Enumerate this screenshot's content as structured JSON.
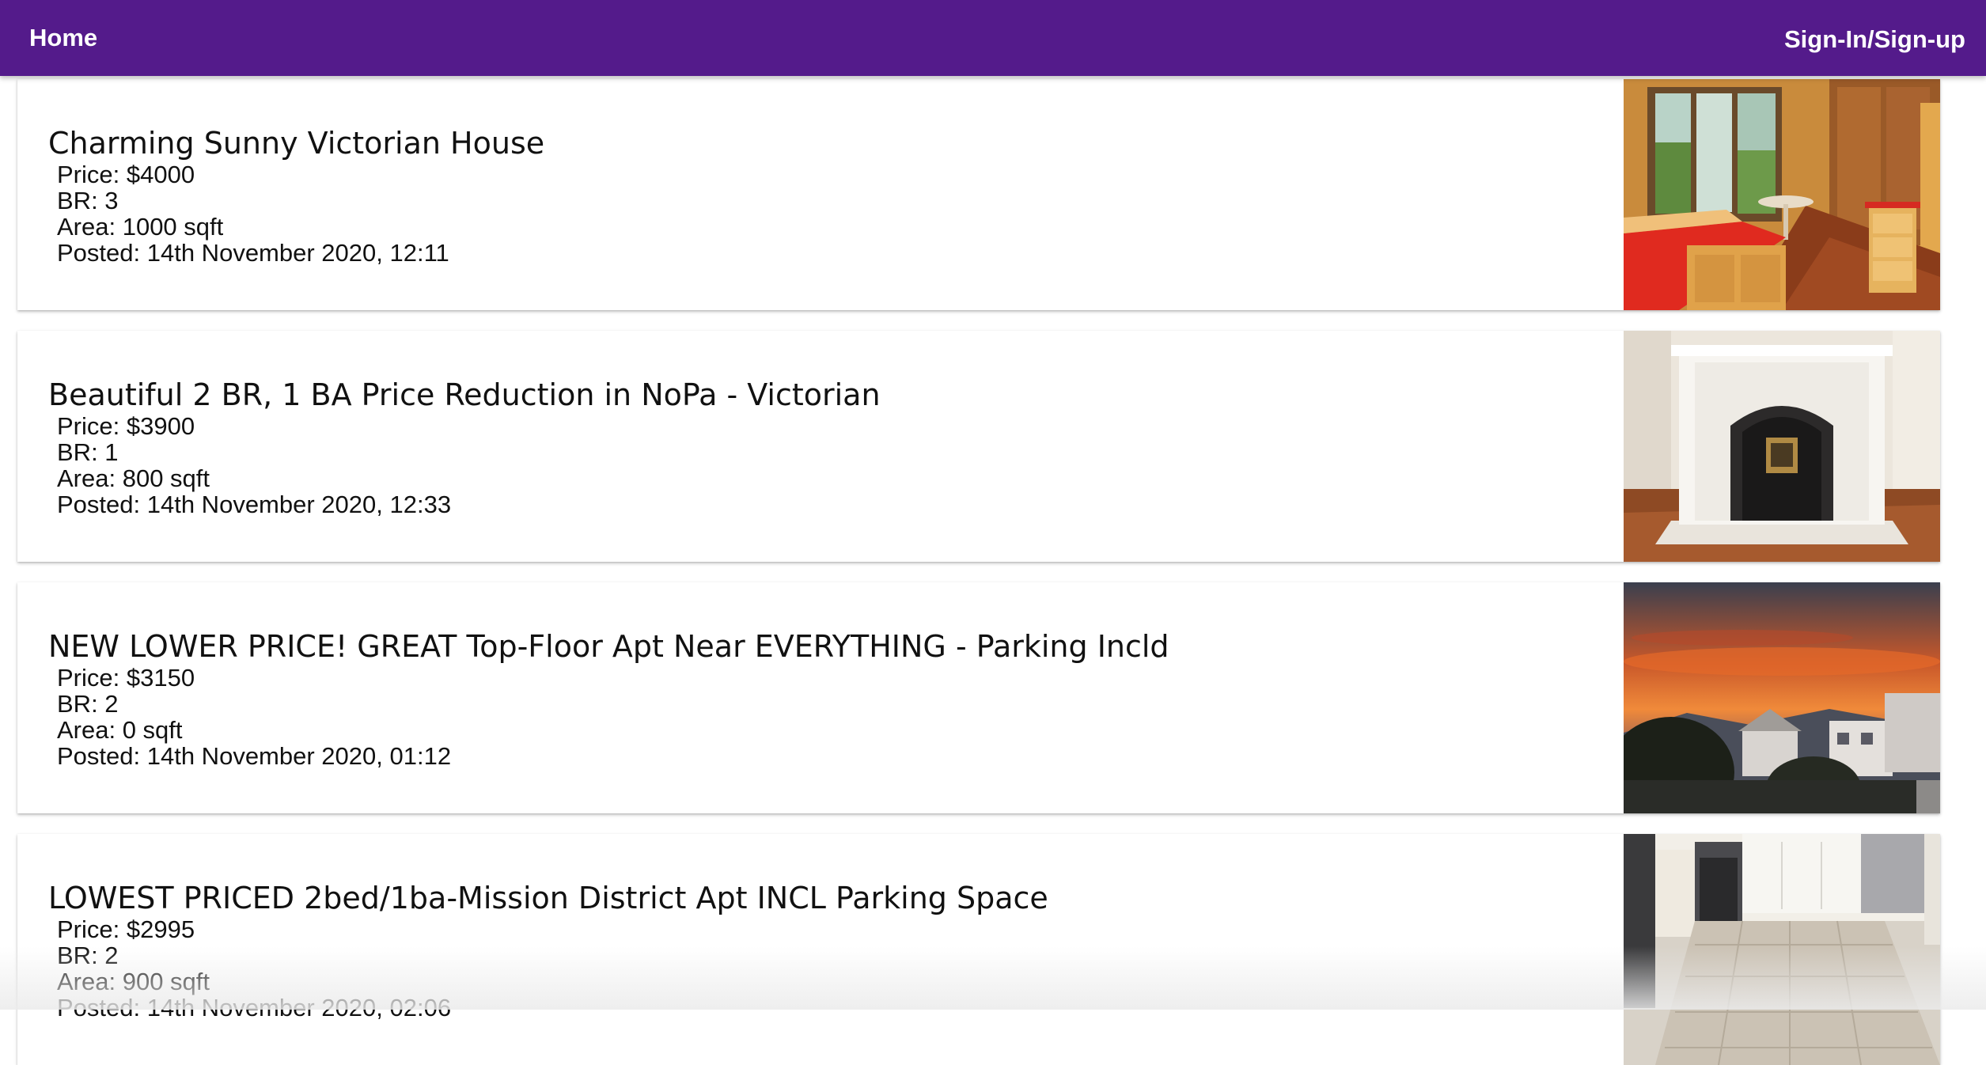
{
  "navbar": {
    "home_label": "Home",
    "signin_label": "Sign-In/Sign-up",
    "background_color": "#541b8b"
  },
  "listings": [
    {
      "title": "Charming Sunny Victorian House",
      "price": "Price: $4000",
      "br": "BR: 3",
      "area": "Area: 1000 sqft",
      "posted": "Posted: 14th November 2020, 12:11",
      "image": "kitchen-photo"
    },
    {
      "title": "Beautiful 2 BR, 1 BA Price Reduction in NoPa - Victorian",
      "price": "Price: $3900",
      "br": "BR: 1",
      "area": "Area: 800 sqft",
      "posted": "Posted: 14th November 2020, 12:33",
      "image": "fireplace-photo"
    },
    {
      "title": "NEW LOWER PRICE! GREAT Top-Floor Apt Near EVERYTHING - Parking Incld",
      "price": "Price: $3150",
      "br": "BR: 2",
      "area": "Area: 0 sqft",
      "posted": "Posted: 14th November 2020, 01:12",
      "image": "sunset-view-photo"
    },
    {
      "title": "LOWEST PRICED 2bed/1ba-Mission District Apt INCL Parking Space",
      "price": "Price: $2995",
      "br": "BR: 2",
      "area": "Area: 900 sqft",
      "posted": "Posted: 14th November 2020, 02:06",
      "image": "kitchen-tile-photo"
    }
  ]
}
